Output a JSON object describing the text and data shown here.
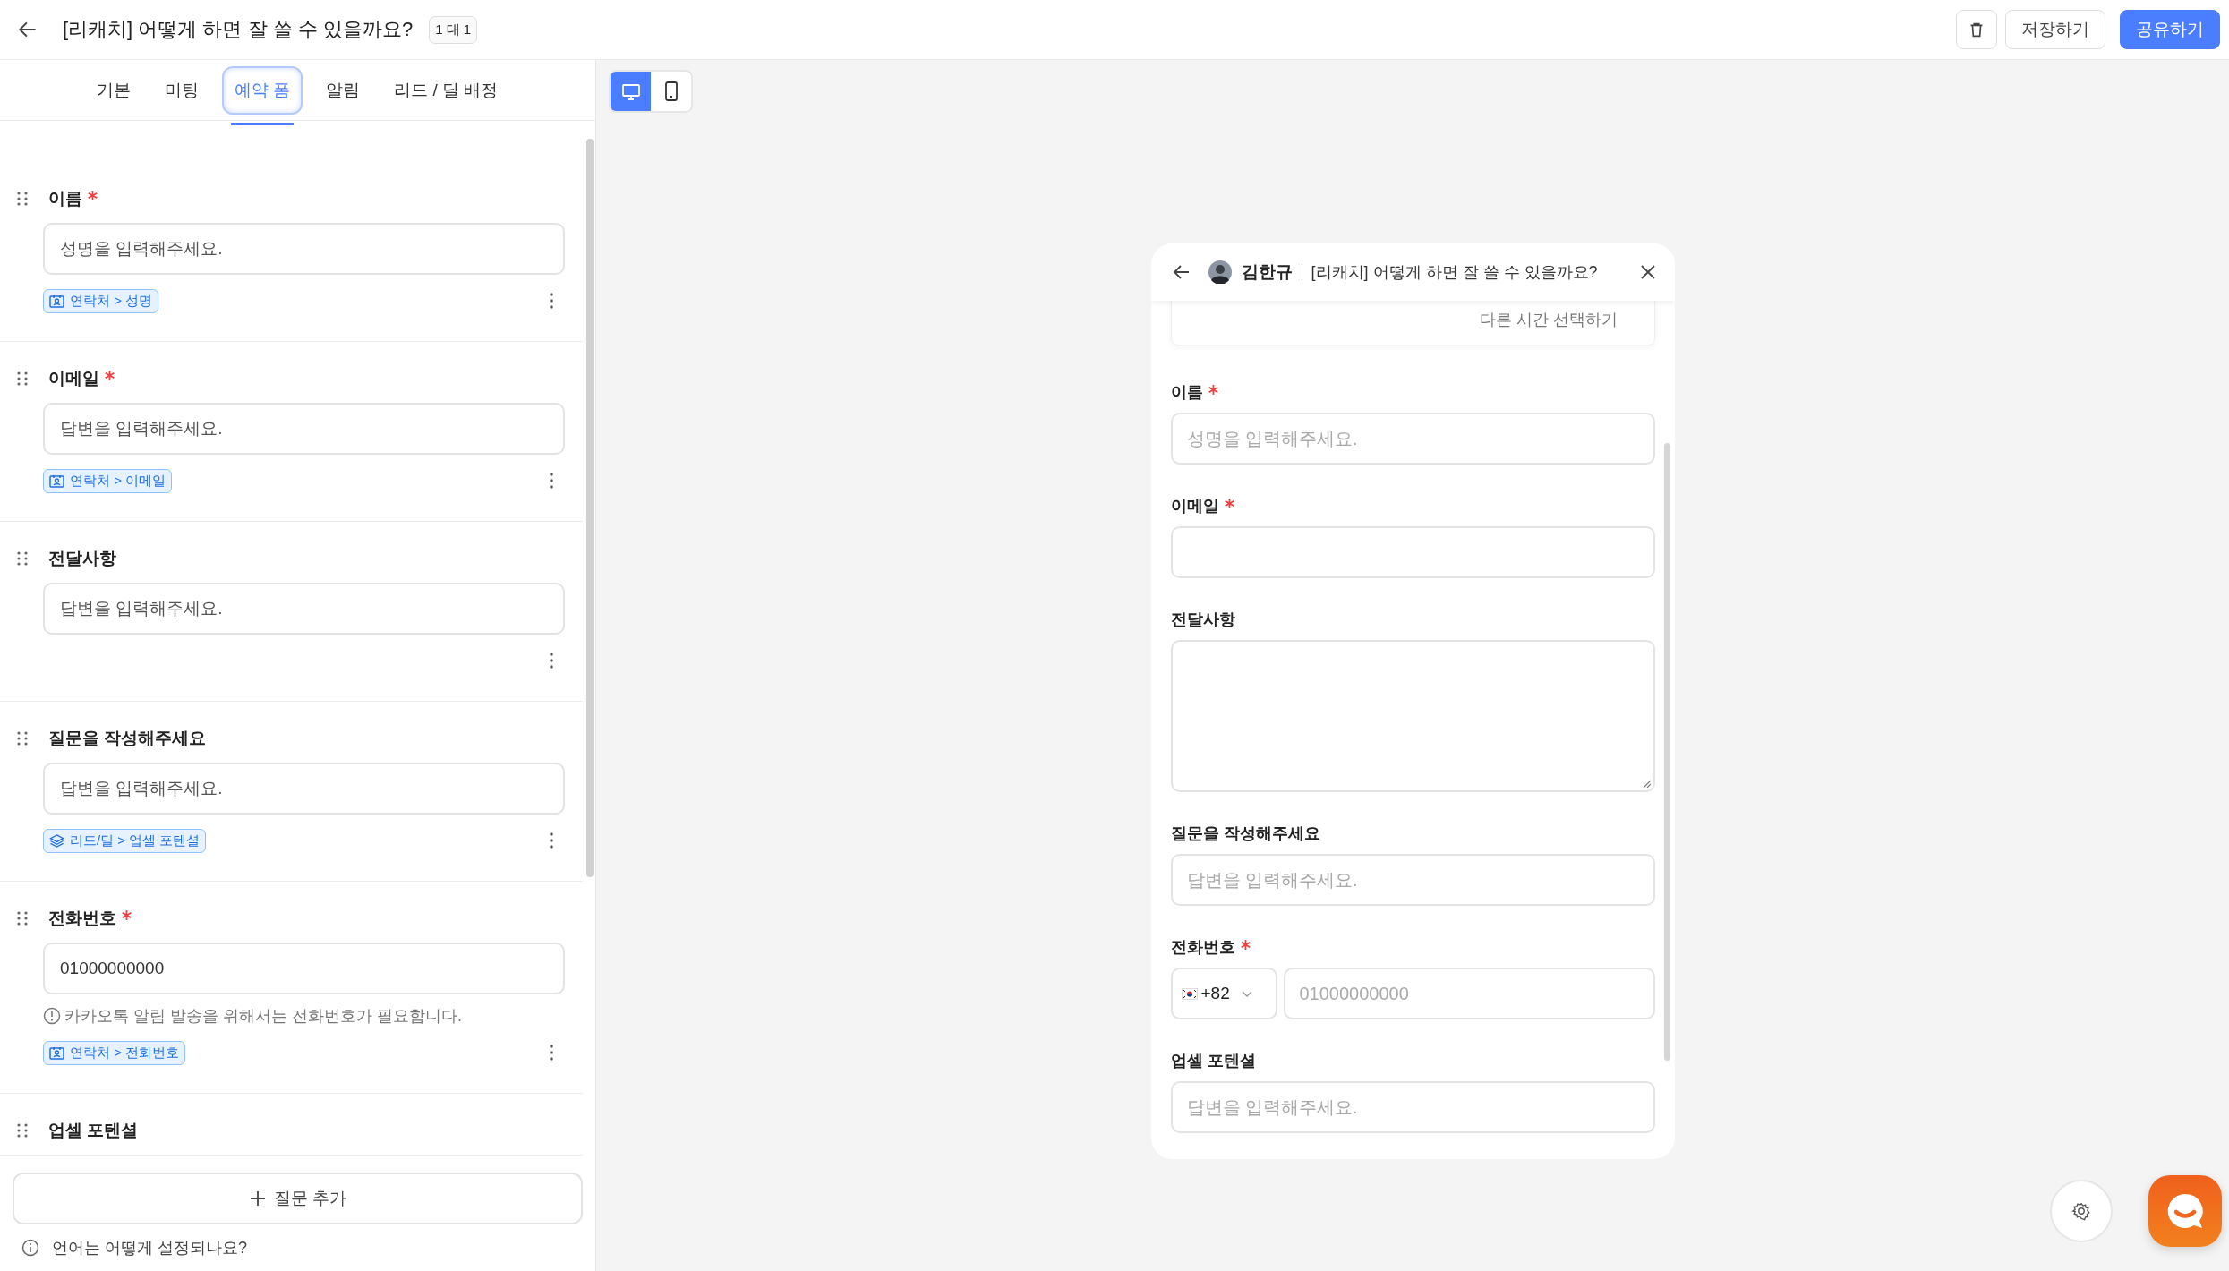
{
  "header": {
    "title": "[리캐치] 어떻게 하면 잘 쓸 수 있을까요?",
    "badge": "1 대 1",
    "buttons": [
      {
        "kind": "delete"
      },
      {
        "kind": "secondary",
        "label": "저장하기"
      },
      {
        "kind": "primary",
        "label": "공유하기"
      }
    ]
  },
  "tabs": [
    {
      "label": "기본",
      "selected": false
    },
    {
      "label": "미팅",
      "selected": false
    },
    {
      "label": "예약 폼",
      "selected": true
    },
    {
      "label": "알림",
      "selected": false
    },
    {
      "label": "리드 / 딜 배정",
      "selected": false
    }
  ],
  "questions": [
    {
      "label": "이름",
      "required": true,
      "placeholder": "성명을 입력해주세요.",
      "tag": {
        "kind": "contact",
        "text": "연락처 > 성명"
      }
    },
    {
      "label": "이메일",
      "required": true,
      "placeholder": "답변을 입력해주세요.",
      "tag": {
        "kind": "contact",
        "text": "연락처 > 이메일"
      }
    },
    {
      "label": "전달사항",
      "required": false,
      "placeholder": "답변을 입력해주세요."
    },
    {
      "label": "질문을 작성해주세요",
      "required": false,
      "placeholder": "답변을 입력해주세요.",
      "tag": {
        "kind": "lead",
        "text": "리드/딜 > 업셀 포텐셜"
      }
    },
    {
      "label": "전화번호",
      "required": true,
      "value": "01000000000",
      "hint": "카카오톡 알림 발송을 위해서는 전화번호가 필요합니다.",
      "tag": {
        "kind": "contact",
        "text": "연락처 > 전화번호"
      }
    },
    {
      "label": "업셀 포텐셜",
      "required": false
    }
  ],
  "add_button": {
    "label": "질문 추가"
  },
  "help": {
    "text": "언어는 어떻게 설정되나요?"
  },
  "view_toggle": [
    {
      "kind": "desktop",
      "selected": true
    },
    {
      "kind": "mobile",
      "selected": false
    }
  ],
  "preview": {
    "host": "김한규",
    "title": "[리캐치] 어떻게 하면 잘 쓸 수 있을까요?",
    "other_time": "다른 시간 선택하기",
    "fields": [
      {
        "kind": "text",
        "label": "이름",
        "required": true,
        "placeholder": "성명을 입력해주세요."
      },
      {
        "kind": "text",
        "label": "이메일",
        "required": true
      },
      {
        "kind": "textarea",
        "label": "전달사항",
        "required": false
      },
      {
        "kind": "text",
        "label": "질문을 작성해주세요",
        "required": false,
        "placeholder": "답변을 입력해주세요."
      },
      {
        "kind": "phone",
        "label": "전화번호",
        "required": true,
        "country_code": "+82",
        "placeholder": "01000000000"
      },
      {
        "kind": "text",
        "label": "업셀 포텐셜",
        "required": false,
        "placeholder": "답변을 입력해주세요."
      }
    ]
  }
}
